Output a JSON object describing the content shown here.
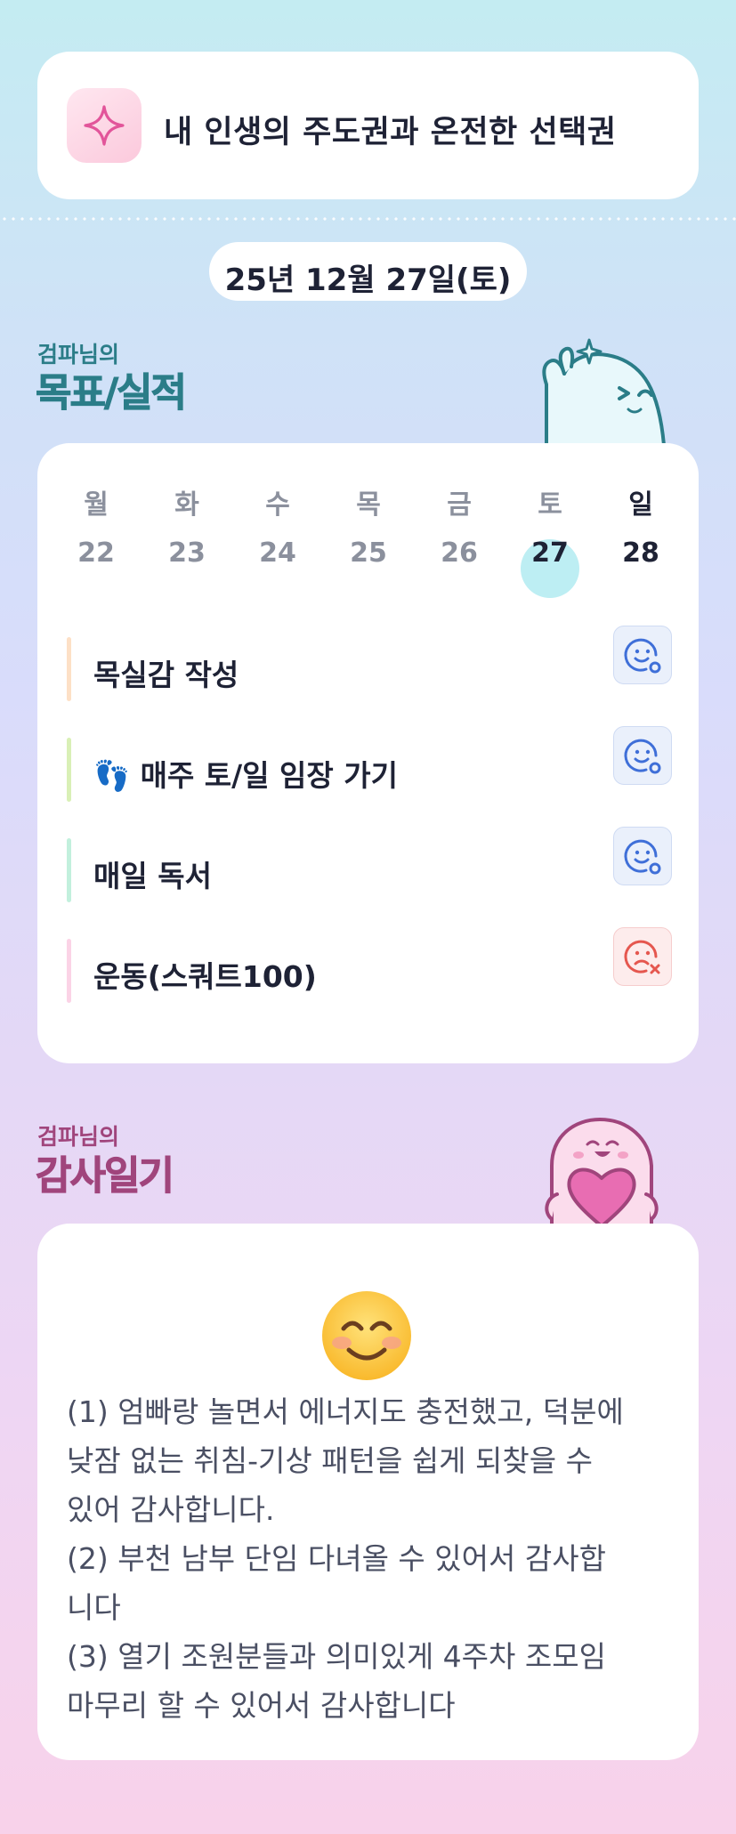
{
  "motto": {
    "text": "내 인생의 주도권과 온전한 선택권"
  },
  "date": {
    "label": "25년 12월 27일(토)"
  },
  "goals_section": {
    "owner": "검파님의",
    "title": "목표/실적"
  },
  "week": {
    "days": [
      {
        "name": "월",
        "num": "22"
      },
      {
        "name": "화",
        "num": "23"
      },
      {
        "name": "수",
        "num": "24"
      },
      {
        "name": "목",
        "num": "25"
      },
      {
        "name": "금",
        "num": "26"
      },
      {
        "name": "토",
        "num": "27"
      },
      {
        "name": "일",
        "num": "28"
      }
    ],
    "today_color": "#bdeef3"
  },
  "goals": [
    {
      "label": "목실감 작성",
      "status": "done",
      "bar_color": "#fde0c6"
    },
    {
      "label": "👣 매주 토/일 임장 가기",
      "status": "done",
      "bar_color": "#d9f0b6"
    },
    {
      "label": "매일 독서",
      "status": "done",
      "bar_color": "#c2f0dd"
    },
    {
      "label": "운동(스쿼트100)",
      "status": "failed",
      "bar_color": "#fbd3e6"
    }
  ],
  "gratitude_section": {
    "owner": "검파님의",
    "title": "감사일기"
  },
  "gratitude": {
    "mood_icon": "smiling-face-icon",
    "lines": [
      "(1) 엄빠랑 놀면서 에너지도 충전했고, 덕분에",
      "낮잠 없는 취침-기상 패턴을 쉽게 되찾을 수",
      "있어 감사합니다.",
      "(2) 부천 남부 단임 다녀올 수 있어서 감사합",
      "니다",
      "(3) 열기 조원분들과 의미있게 4주차 조모임",
      "마무리 할 수 있어서 감사합니다"
    ]
  },
  "colors": {
    "goal_title": "#2b7d88",
    "gratitude_title": "#a0457c",
    "done_icon": "#3f6fd8",
    "failed_icon": "#e5574f"
  }
}
